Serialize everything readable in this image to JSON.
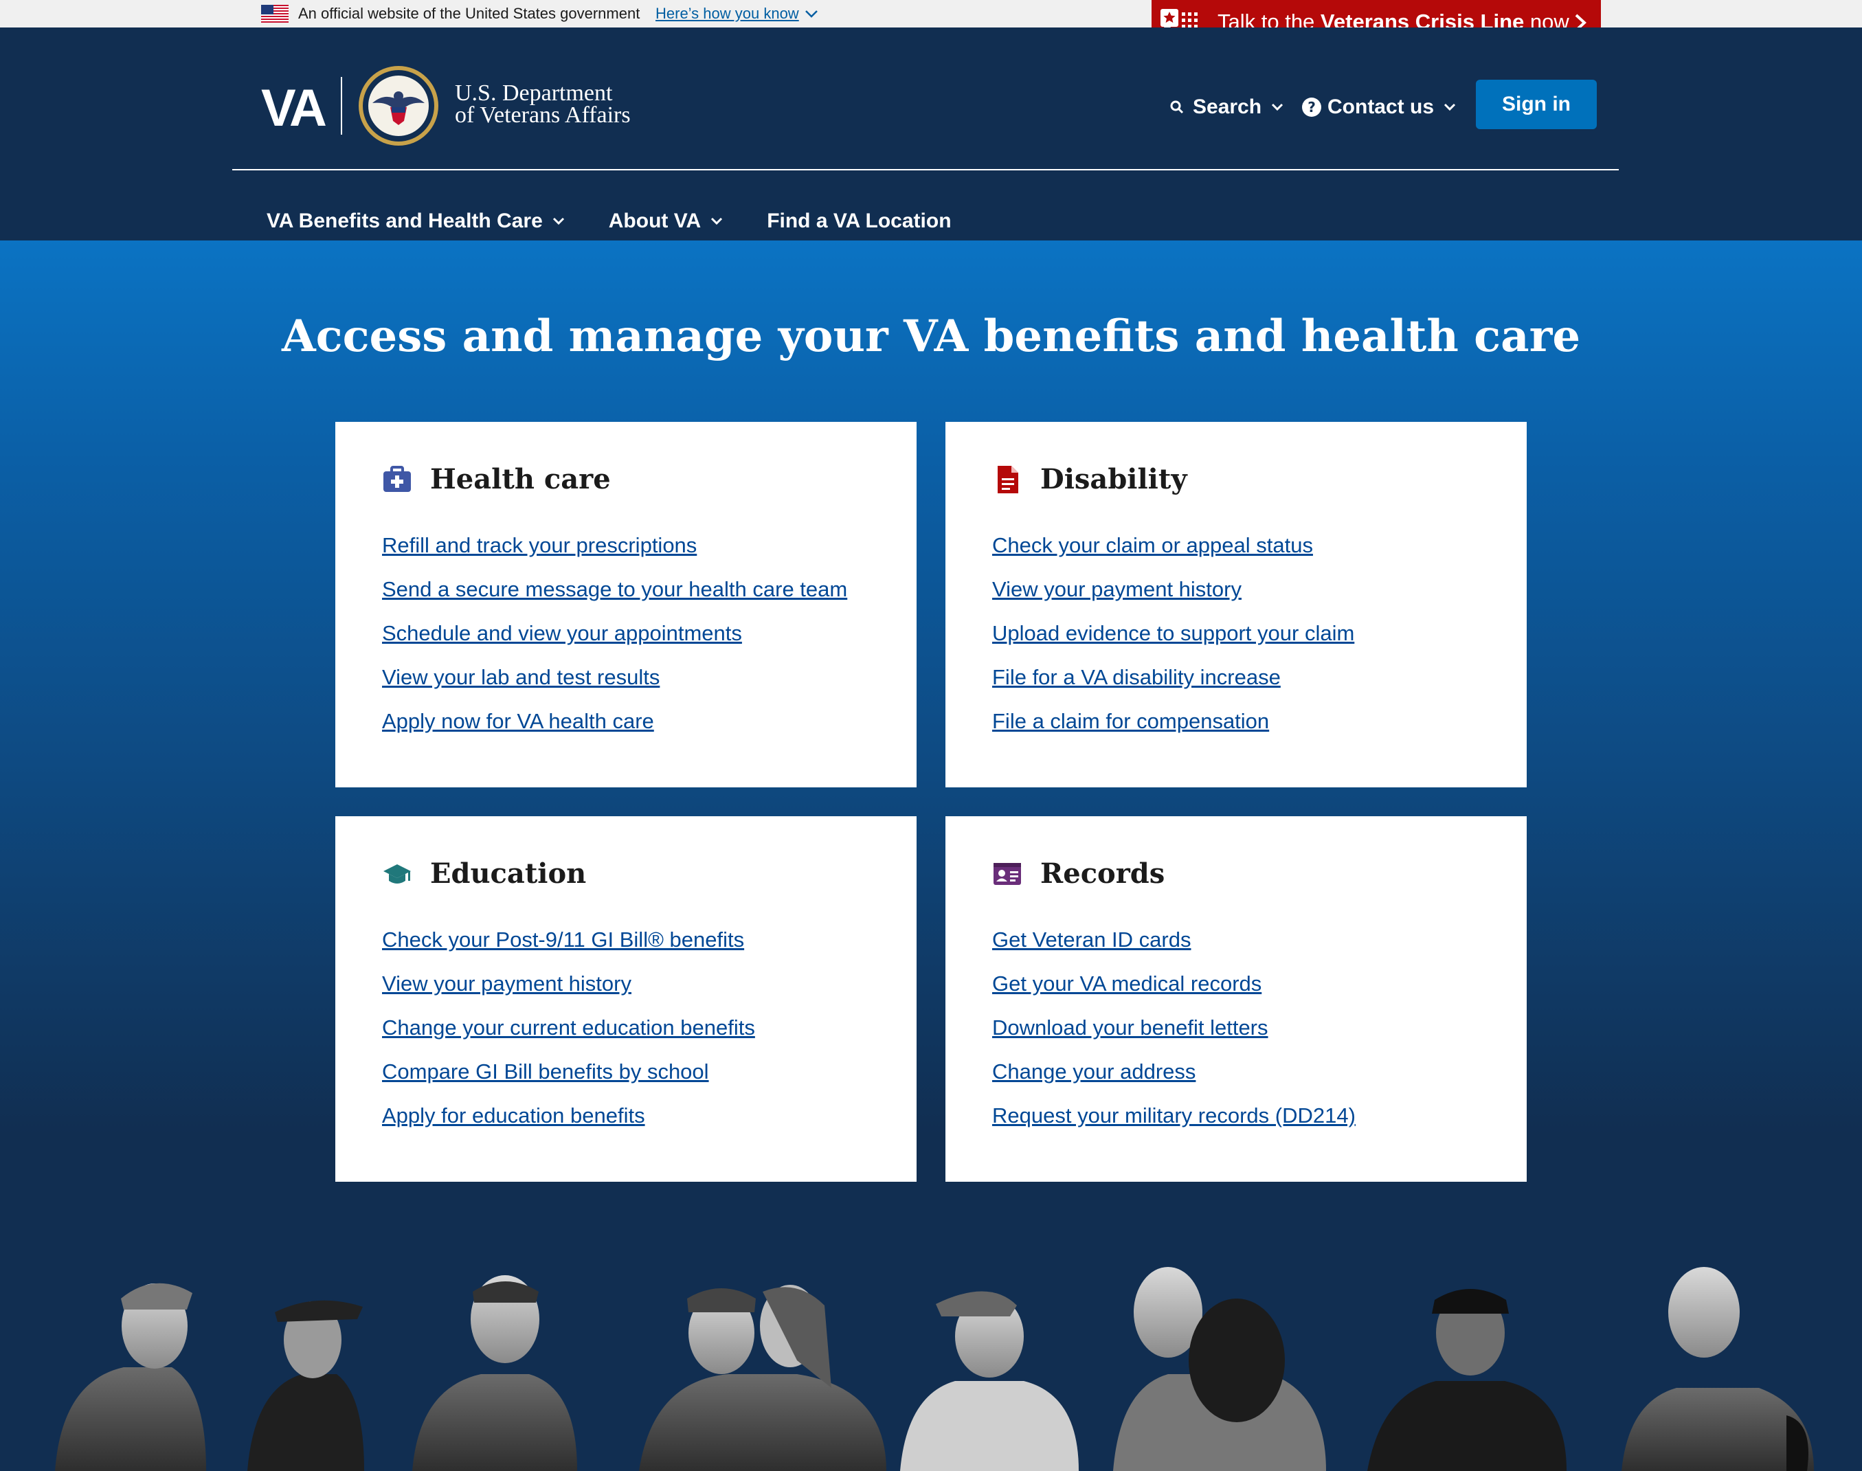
{
  "gov_banner": {
    "text": "An official website of the United States government",
    "link": "Here’s how you know"
  },
  "crisis": {
    "prefix": "Talk to the ",
    "bold": "Veterans Crisis Line",
    "suffix": " now"
  },
  "header": {
    "logo_letters": "VA",
    "dept_line1": "U.S. Department",
    "dept_line2": "of Veterans Affairs",
    "search_label": "Search",
    "contact_label": "Contact us",
    "signin_label": "Sign in"
  },
  "nav": {
    "items": [
      {
        "label": "VA Benefits and Health Care",
        "has_menu": true
      },
      {
        "label": "About VA",
        "has_menu": true
      },
      {
        "label": "Find a VA Location",
        "has_menu": false
      }
    ]
  },
  "hero": {
    "title": "Access and manage your VA benefits and health care"
  },
  "cards": [
    {
      "title": "Health care",
      "icon": "medical-kit-icon",
      "icon_color": "#3f57a6",
      "links": [
        "Refill and track your prescriptions",
        "Send a secure message to your health care team",
        "Schedule and view your appointments",
        "View your lab and test results",
        "Apply now for VA health care"
      ]
    },
    {
      "title": "Disability",
      "icon": "document-icon",
      "icon_color": "#b50909",
      "links": [
        "Check your claim or appeal status",
        "View your payment history",
        "Upload evidence to support your claim",
        "File for a VA disability increase",
        "File a claim for compensation"
      ]
    },
    {
      "title": "Education",
      "icon": "graduation-cap-icon",
      "icon_color": "#20787b",
      "links": [
        "Check your Post-9/11 GI Bill® benefits",
        "View your payment history",
        "Change your current education benefits",
        "Compare GI Bill benefits by school",
        "Apply for education benefits"
      ]
    },
    {
      "title": "Records",
      "icon": "id-card-icon",
      "icon_color": "#6a2e7a",
      "links": [
        "Get Veteran ID cards",
        "Get your VA medical records",
        "Download your benefit letters",
        "Change your address",
        "Request your military records (DD214)"
      ]
    }
  ],
  "colors": {
    "header_bg": "#112e51",
    "hero_top": "#0b73c3",
    "link": "#004795",
    "signin_bg": "#0071bb",
    "crisis_bg": "#b50909"
  }
}
